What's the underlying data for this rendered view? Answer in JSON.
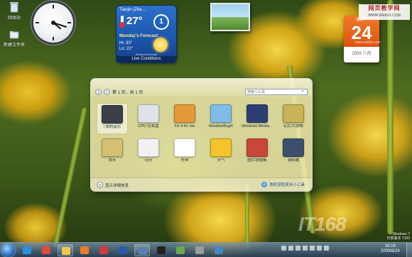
{
  "desktop": {
    "icons": [
      {
        "label": "回收站",
        "icon": "recycle-bin-icon"
      },
      {
        "label": "新建文件夹",
        "icon": "folder-icon"
      }
    ]
  },
  "clock": {
    "hour": 4,
    "minute": 18
  },
  "weather": {
    "city": "Tianjin (Zha…",
    "temp": "27°",
    "uv": "1",
    "forecast_title": "Monday's Forecast",
    "hi": "Hi: 33°",
    "lo": "Lo: 22°",
    "attribution": "Sedona.Forecast",
    "tab": "Live Conditions"
  },
  "calendar": {
    "weekday": "星期一",
    "day": "24",
    "month_year": "2009 八月"
  },
  "watermark": {
    "site_cn": "网页教学网",
    "site_url": "WWW.WEBJX.COM",
    "mid_url": "www.webjx.com",
    "brand": "IT168"
  },
  "gallery": {
    "page_label": "第 1 页，共 1 页",
    "search_placeholder": "搜索小工具",
    "items": [
      {
        "label": "i 我的音乐",
        "icon": "music-player-icon",
        "color": "#3b3f48",
        "selected": true
      },
      {
        "label": "CPU 仪表盘",
        "icon": "cpu-meter-icon",
        "color": "#dfe3e8",
        "selected": false
      },
      {
        "label": "Fix it for me",
        "icon": "fix-it-icon",
        "color": "#e39a3a",
        "selected": false
      },
      {
        "label": "WeatherBug®",
        "icon": "weatherbug-icon",
        "color": "#7fbde8",
        "selected": false
      },
      {
        "label": "Windows Media…",
        "icon": "windows-media-icon",
        "color": "#2d3f72",
        "selected": false
      },
      {
        "label": "幻灯片放映",
        "icon": "slideshow-icon",
        "color": "#c9b356",
        "selected": false
      },
      {
        "label": "货币",
        "icon": "currency-icon",
        "color": "#d4c070",
        "selected": false
      },
      {
        "label": "日历",
        "icon": "calendar-icon",
        "color": "#f1f1f1",
        "selected": false
      },
      {
        "label": "时钟",
        "icon": "clock-icon",
        "color": "#ffffff",
        "selected": false
      },
      {
        "label": "天气",
        "icon": "weather-icon",
        "color": "#f5c32a",
        "selected": false
      },
      {
        "label": "图片拼图板",
        "icon": "picture-puzzle-icon",
        "color": "#c9463a",
        "selected": false
      },
      {
        "label": "源标题",
        "icon": "feed-headlines-icon",
        "color": "#3c4f6b",
        "selected": false
      }
    ],
    "details_label": "显示详细信息",
    "more_label": "联机获取更多小工具"
  },
  "taskbar": {
    "apps": [
      {
        "name": "ie-icon",
        "color": "#2a8fe0",
        "pinned": false
      },
      {
        "name": "chrome-icon",
        "color": "#e04b36",
        "pinned": false
      },
      {
        "name": "explorer-icon",
        "color": "#f2c94c",
        "pinned": true
      },
      {
        "name": "media-player-icon",
        "color": "#ef7b23",
        "pinned": false
      },
      {
        "name": "mail-icon",
        "color": "#d23c3c",
        "pinned": false
      },
      {
        "name": "word-icon",
        "color": "#2b5aa8",
        "pinned": false
      },
      {
        "name": "gadgets-icon",
        "color": "#5a7fb5",
        "pinned": true
      },
      {
        "name": "qq-icon",
        "color": "#222222",
        "pinned": false
      },
      {
        "name": "app-icon",
        "color": "#6aa84f",
        "pinned": false
      },
      {
        "name": "tools-icon",
        "color": "#9b9b9b",
        "pinned": false
      },
      {
        "name": "remote-desktop-icon",
        "color": "#4a86c5",
        "pinned": false
      }
    ],
    "time": "16:19",
    "date": "2009/8/24",
    "os_label_1": "Windows 7",
    "os_label_2": "内部版本 7100"
  }
}
